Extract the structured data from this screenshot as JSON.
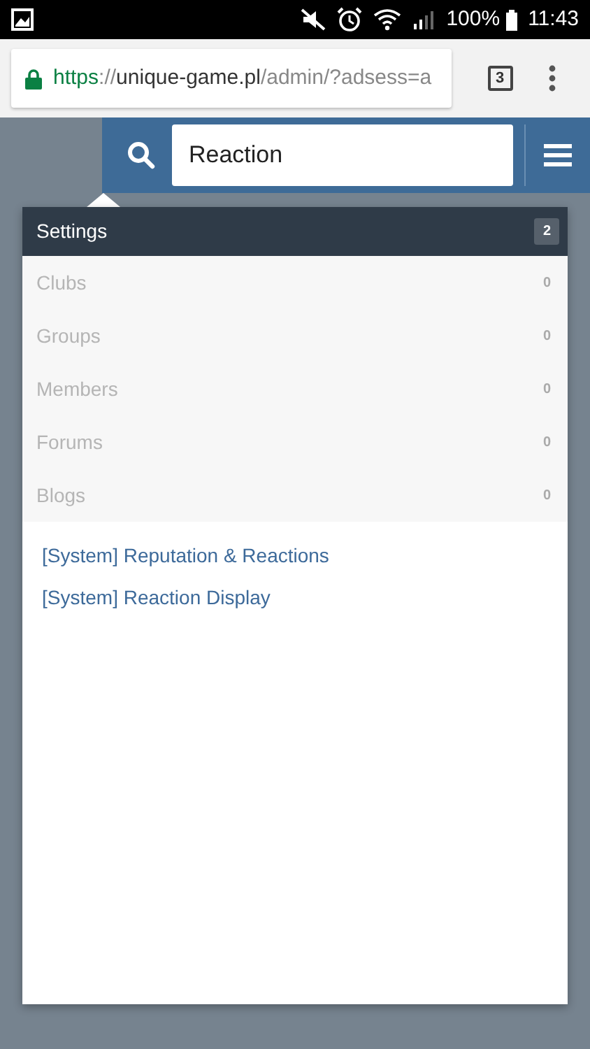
{
  "status_bar": {
    "battery": "100%",
    "time": "11:43"
  },
  "browser": {
    "url": {
      "scheme": "https",
      "separator": "://",
      "host": "unique-game.pl",
      "path": "/admin/?adsess=a"
    },
    "tab_count": "3"
  },
  "search": {
    "value": "Reaction"
  },
  "categories": [
    {
      "label": "Settings",
      "count": "2",
      "selected": true
    },
    {
      "label": "Clubs",
      "count": "0",
      "selected": false
    },
    {
      "label": "Groups",
      "count": "0",
      "selected": false
    },
    {
      "label": "Members",
      "count": "0",
      "selected": false
    },
    {
      "label": "Forums",
      "count": "0",
      "selected": false
    },
    {
      "label": "Blogs",
      "count": "0",
      "selected": false
    }
  ],
  "results": [
    "[System] Reputation & Reactions",
    "[System] Reaction Display"
  ]
}
